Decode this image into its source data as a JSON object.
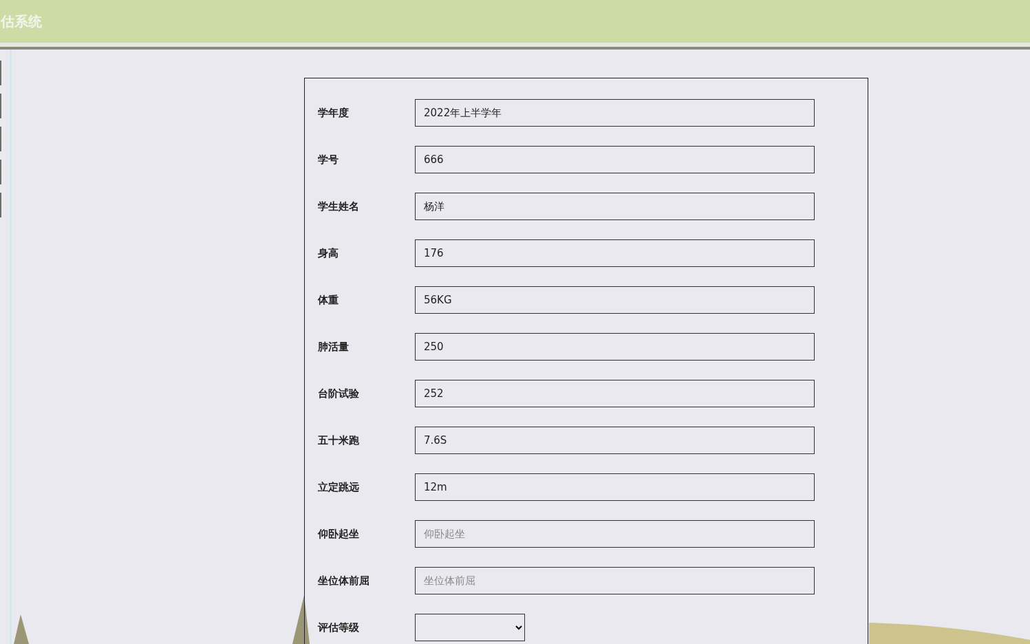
{
  "header": {
    "title": "估系统"
  },
  "form": {
    "fields": [
      {
        "kind": "input",
        "label": "学年度",
        "value": "2022年上半学年"
      },
      {
        "kind": "input",
        "label": "学号",
        "value": "666"
      },
      {
        "kind": "input",
        "label": "学生姓名",
        "value": "杨洋"
      },
      {
        "kind": "input",
        "label": "身高",
        "value": "176"
      },
      {
        "kind": "input",
        "label": "体重",
        "value": "56KG"
      },
      {
        "kind": "input",
        "label": "肺活量",
        "value": "250"
      },
      {
        "kind": "input",
        "label": "台阶试验",
        "value": "252"
      },
      {
        "kind": "input",
        "label": "五十米跑",
        "value": "7.6S"
      },
      {
        "kind": "input",
        "label": "立定跳远",
        "value": "12m"
      },
      {
        "kind": "input",
        "label": "仰卧起坐",
        "placeholder": "仰卧起坐"
      },
      {
        "kind": "input",
        "label": "坐位体前屈",
        "placeholder": "坐位体前屈"
      },
      {
        "kind": "select",
        "label": "评估等级"
      }
    ]
  }
}
